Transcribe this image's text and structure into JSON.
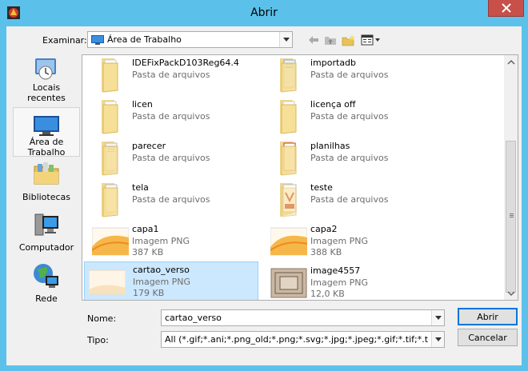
{
  "window": {
    "title": "Abrir"
  },
  "lookin": {
    "label": "Examinar:",
    "value": "Área de Trabalho"
  },
  "places": [
    {
      "label": "Locais recentes",
      "icon": "recent-places-icon"
    },
    {
      "label": "Área de Trabalho",
      "icon": "desktop-icon"
    },
    {
      "label": "Bibliotecas",
      "icon": "libraries-icon"
    },
    {
      "label": "Computador",
      "icon": "computer-icon"
    },
    {
      "label": "Rede",
      "icon": "network-icon"
    }
  ],
  "files": [
    {
      "name": "IDEFixPackD103Reg64.4",
      "type": "Pasta de arquivos",
      "size": ""
    },
    {
      "name": "importadb",
      "type": "Pasta de arquivos",
      "size": ""
    },
    {
      "name": "licen",
      "type": "Pasta de arquivos",
      "size": ""
    },
    {
      "name": "licença off",
      "type": "Pasta de arquivos",
      "size": ""
    },
    {
      "name": "parecer",
      "type": "Pasta de arquivos",
      "size": ""
    },
    {
      "name": "planilhas",
      "type": "Pasta de arquivos",
      "size": ""
    },
    {
      "name": "tela",
      "type": "Pasta de arquivos",
      "size": ""
    },
    {
      "name": "teste",
      "type": "Pasta de arquivos",
      "size": ""
    },
    {
      "name": "capa1",
      "type": "Imagem PNG",
      "size": "387 KB"
    },
    {
      "name": "capa2",
      "type": "Imagem PNG",
      "size": "388 KB"
    },
    {
      "name": "cartao_verso",
      "type": "Imagem PNG",
      "size": "179 KB"
    },
    {
      "name": "image4557",
      "type": "Imagem PNG",
      "size": "12,0 KB"
    }
  ],
  "filename": {
    "label": "Nome:",
    "value": "cartao_verso"
  },
  "filetype": {
    "label": "Tipo:",
    "value": "All (*.gif;*.ani;*.png_old;*.png;*.svg;*.jpg;*.jpeg;*.gif;*.tif;*.tiff;*.png;*.jpg;"
  },
  "buttons": {
    "open": "Abrir",
    "cancel": "Cancelar"
  }
}
